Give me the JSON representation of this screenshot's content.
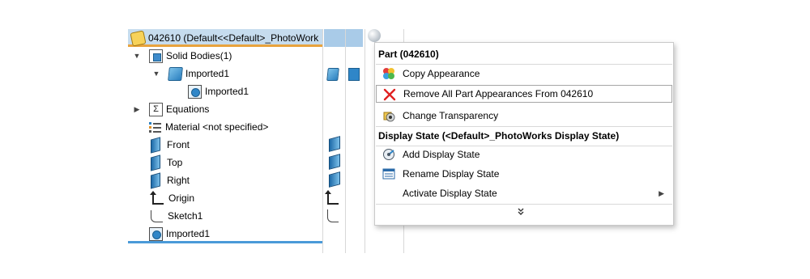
{
  "tree": {
    "root_label": "042610  (Default<<Default>_PhotoWork",
    "items": [
      {
        "label": "Solid Bodies(1)",
        "icon": "solid-bodies-folder-icon"
      },
      {
        "label": "Imported1",
        "icon": "body-cube-icon"
      },
      {
        "label": "Imported1",
        "icon": "imported-body-icon"
      },
      {
        "label": "Equations",
        "icon": "equations-sigma-icon"
      },
      {
        "label": "Material <not specified>",
        "icon": "material-icon"
      },
      {
        "label": "Front",
        "icon": "plane-icon"
      },
      {
        "label": "Top",
        "icon": "plane-icon"
      },
      {
        "label": "Right",
        "icon": "plane-icon"
      },
      {
        "label": "Origin",
        "icon": "origin-icon"
      },
      {
        "label": "Sketch1",
        "icon": "sketch-icon"
      },
      {
        "label": "Imported1",
        "icon": "imported-feature-icon"
      }
    ]
  },
  "menu": {
    "header_part": "Part (042610)",
    "items_part": [
      {
        "label": "Copy Appearance",
        "icon": "copy-appearance-icon"
      },
      {
        "label": "Remove All Part Appearances From 042610",
        "icon": "remove-x-icon"
      },
      {
        "label": "Change Transparency",
        "icon": "transparency-icon"
      }
    ],
    "header_display": "Display State (<Default>_PhotoWorks Display State)",
    "items_display": [
      {
        "label": "Add Display State",
        "icon": "add-display-state-icon"
      },
      {
        "label": "Rename Display State",
        "icon": "rename-display-state-icon"
      },
      {
        "label": "Activate Display State",
        "icon": "",
        "submenu": true
      }
    ],
    "more_glyph": "»"
  },
  "colors": {
    "selection": "#c6dcee",
    "accent_orange": "#e8a33d",
    "accent_blue": "#4a9ad8",
    "remove_red": "#e02020"
  }
}
